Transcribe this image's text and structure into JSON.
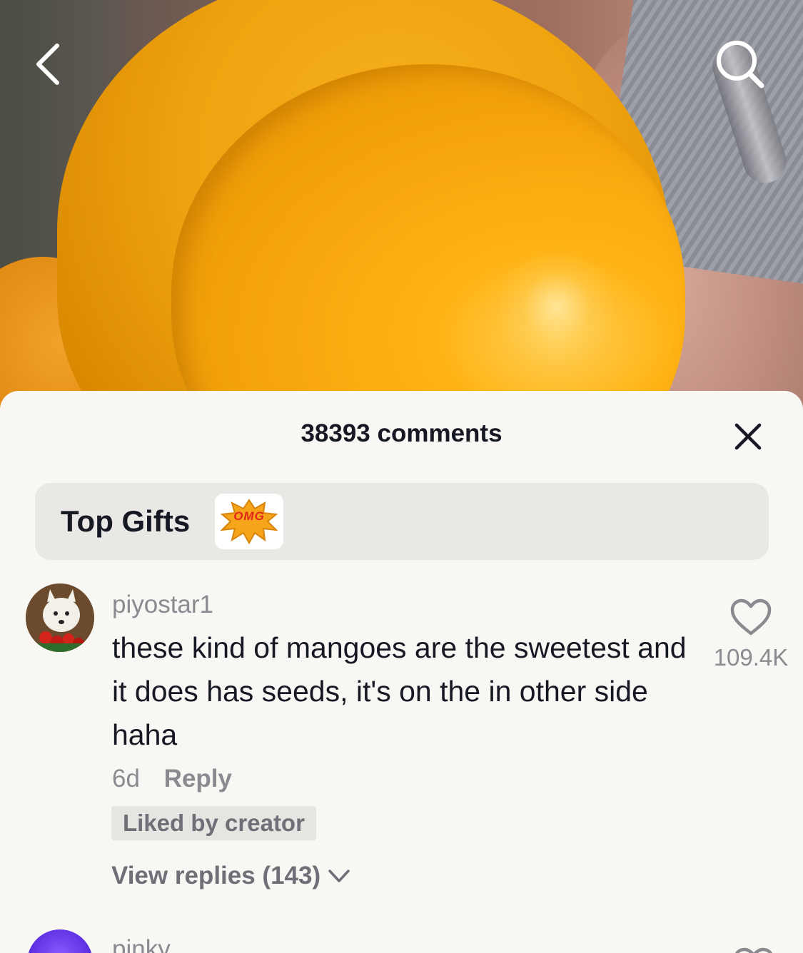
{
  "video": {
    "description_icon": "mango-video-frame"
  },
  "top_bar": {
    "back_icon": "chevron-left-icon",
    "search_icon": "search-icon"
  },
  "comments_panel": {
    "title": "38393 comments",
    "close_icon": "close-icon",
    "top_gifts": {
      "label": "Top Gifts",
      "gift_text": "OMG"
    },
    "comments": [
      {
        "username": "piyostar1",
        "text": "these kind of mangoes are the sweetest and it does has seeds, it's on the in other side haha",
        "age": "6d",
        "reply_label": "Reply",
        "liked_by_creator": "Liked by creator",
        "view_replies": "View replies (143)",
        "likes": "109.4K"
      },
      {
        "username": "pinky"
      }
    ]
  },
  "colors": {
    "sheet_bg": "#f8f7f4",
    "text_primary": "#161823",
    "text_secondary": "#8a8b91"
  }
}
